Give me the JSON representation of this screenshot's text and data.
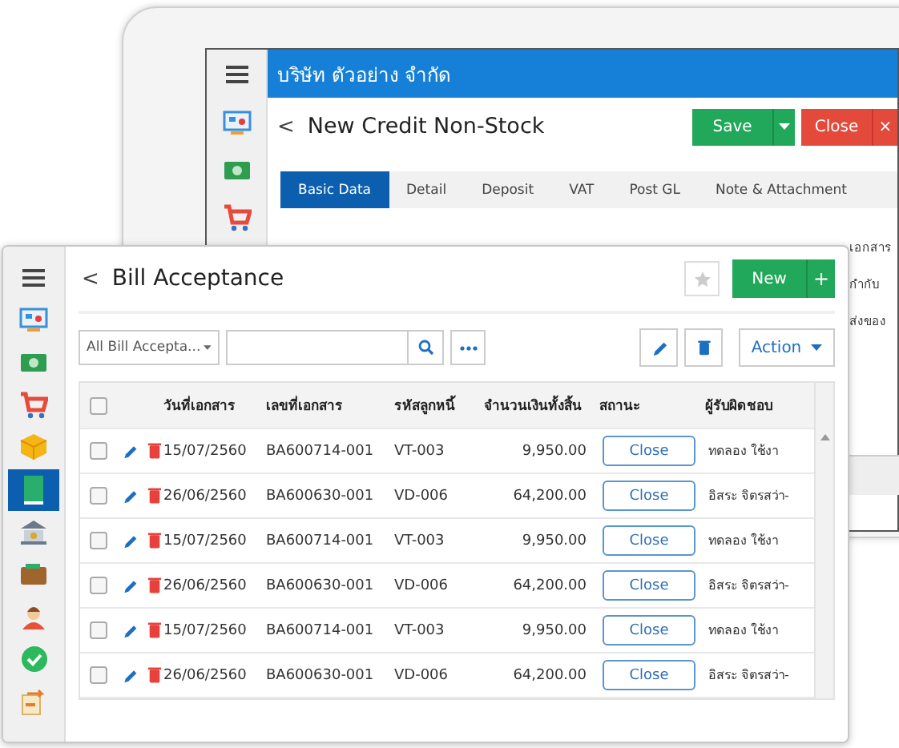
{
  "back_window": {
    "company": "บริษัท ตัวอย่าง จำกัด",
    "back": "<",
    "title": "New Credit Non-Stock",
    "save_button": "Save",
    "close_button": "Close",
    "close_mark": "×",
    "sidebar": [
      {
        "kind": "menu",
        "selected": false
      },
      {
        "kind": "monitor",
        "selected": false
      },
      {
        "kind": "money",
        "selected": false
      },
      {
        "kind": "cart",
        "selected": false
      }
    ],
    "tabs": [
      {
        "label": "Basic Data",
        "selected": true
      },
      {
        "label": "Detail",
        "selected": false
      },
      {
        "label": "Deposit",
        "selected": false
      },
      {
        "label": "VAT",
        "selected": false
      },
      {
        "label": "Post GL",
        "selected": false
      },
      {
        "label": "Note & Attachment",
        "selected": false
      }
    ],
    "field_labels": [
      "เอกสาร",
      "กำกับ",
      "ส่งของ"
    ]
  },
  "front_window": {
    "back": "<",
    "title": "Bill Acceptance",
    "new_button": "New",
    "new_plus": "+",
    "sidebar": [
      {
        "kind": "menu",
        "selected": false
      },
      {
        "kind": "monitor",
        "selected": false
      },
      {
        "kind": "money",
        "selected": false
      },
      {
        "kind": "cart",
        "selected": false
      },
      {
        "kind": "cube",
        "selected": false
      },
      {
        "kind": "book",
        "selected": true
      },
      {
        "kind": "bank",
        "selected": false
      },
      {
        "kind": "wallet",
        "selected": false
      },
      {
        "kind": "person",
        "selected": false
      },
      {
        "kind": "check",
        "selected": false
      },
      {
        "kind": "document",
        "selected": false
      }
    ],
    "filter": "All Bill Accepta...",
    "action_button": "Action",
    "table": {
      "all_checked": false,
      "columns": [
        "วันที่เอกสาร",
        "เลขที่เอกสาร",
        "รหัสลูกหนี้",
        "จำนวนเงินทั้งสิ้น",
        "สถานะ",
        "ผู้รับผิดชอบ"
      ],
      "rows": [
        {
          "date": "15/07/2560",
          "doc_no": "BA600714-001",
          "customer": "VT-003",
          "amount": "9,950.00",
          "status": "Close",
          "responsible": "ทดลอง ใช้งา",
          "checked": false
        },
        {
          "date": "26/06/2560",
          "doc_no": "BA600630-001",
          "customer": "VD-006",
          "amount": "64,200.00",
          "status": "Close",
          "responsible": "อิสระ จิตรสว่า-",
          "checked": false
        },
        {
          "date": "15/07/2560",
          "doc_no": "BA600714-001",
          "customer": "VT-003",
          "amount": "9,950.00",
          "status": "Close",
          "responsible": "ทดลอง ใช้งา",
          "checked": false
        },
        {
          "date": "26/06/2560",
          "doc_no": "BA600630-001",
          "customer": "VD-006",
          "amount": "64,200.00",
          "status": "Close",
          "responsible": "อิสระ จิตรสว่า-",
          "checked": false
        },
        {
          "date": "15/07/2560",
          "doc_no": "BA600714-001",
          "customer": "VT-003",
          "amount": "9,950.00",
          "status": "Close",
          "responsible": "ทดลอง ใช้งา",
          "checked": false
        },
        {
          "date": "26/06/2560",
          "doc_no": "BA600630-001",
          "customer": "VD-006",
          "amount": "64,200.00",
          "status": "Close",
          "responsible": "อิสระ จิตรสว่า-",
          "checked": false
        }
      ]
    }
  }
}
